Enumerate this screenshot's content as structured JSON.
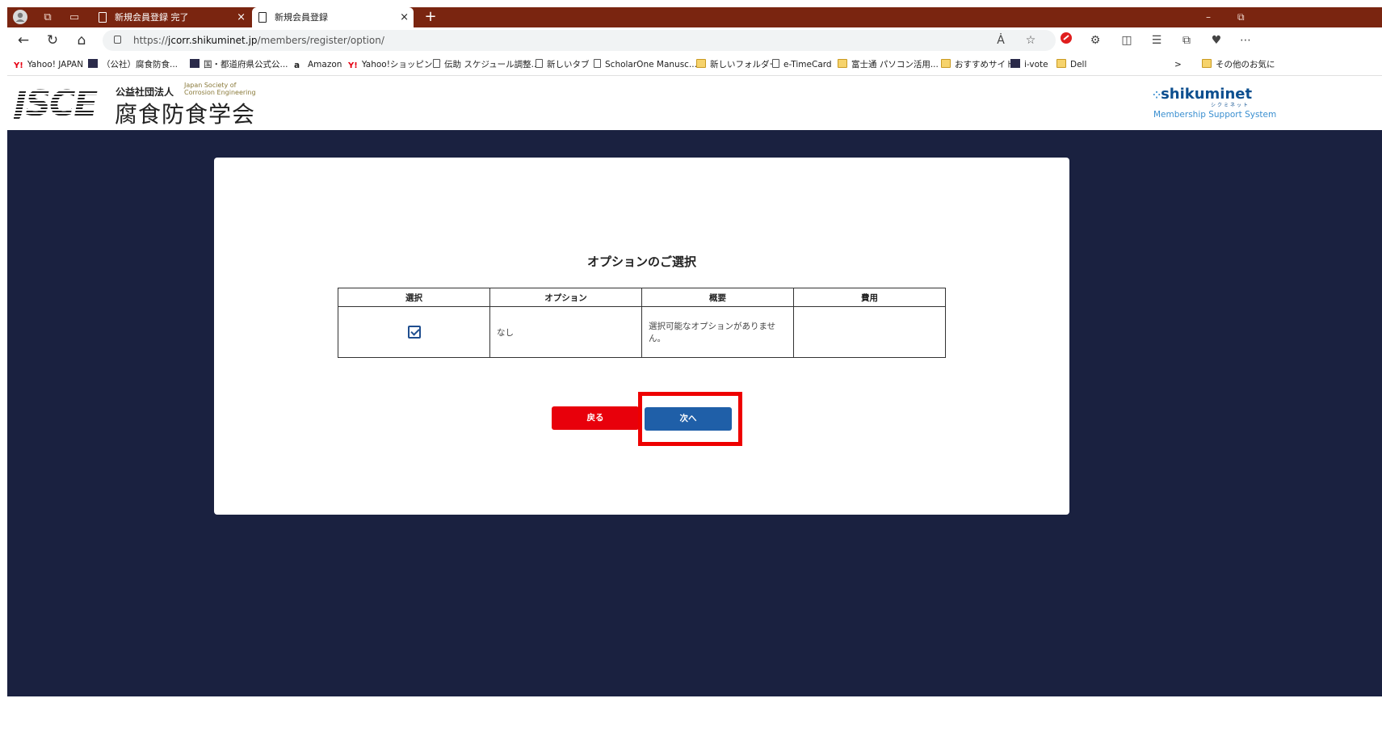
{
  "browser": {
    "tabs": [
      {
        "label": "新規会員登録 完了",
        "close": "×"
      },
      {
        "label": "新規会員登録",
        "close": "×"
      }
    ],
    "new_tab": "+",
    "window_controls": {
      "minimize": "–",
      "restore": "⧉"
    },
    "url": {
      "prefix": "https://",
      "domain": "jcorr.shikuminet.jp",
      "path": "/members/register/option/"
    },
    "read_aloud": "Ȧ"
  },
  "bookmarks": [
    {
      "label": "Yahoo! JAPAN",
      "icon": "yahoo"
    },
    {
      "label": "（公社）腐食防食...",
      "icon": "block"
    },
    {
      "label": "国・都道府県公式公...",
      "icon": "block"
    },
    {
      "label": "Amazon",
      "icon": "amazon"
    },
    {
      "label": "Yahoo!ショッピング",
      "icon": "yahoo"
    },
    {
      "label": "伝助 スケジュール調整...",
      "icon": "page"
    },
    {
      "label": "新しいタブ",
      "icon": "page"
    },
    {
      "label": "ScholarOne Manusc...",
      "icon": "page"
    },
    {
      "label": "新しいフォルダー",
      "icon": "folder"
    },
    {
      "label": "e-TimeCard",
      "icon": "page"
    },
    {
      "label": "富士通 パソコン活用...",
      "icon": "folder"
    },
    {
      "label": "おすすめサイト",
      "icon": "folder"
    },
    {
      "label": "i-vote",
      "icon": "block"
    },
    {
      "label": "Dell",
      "icon": "folder"
    }
  ],
  "bookmarks_more": ">",
  "bookmarks_other": "その他のお気に",
  "site": {
    "logo_text": "JSCE",
    "org_type": "公益社団法人",
    "org_en": "Japan Society of\nCorrosion Engineering",
    "org_name": "腐食防食学会",
    "system_logo": "shikuminet",
    "system_logo_kana": "シクミネット",
    "system_name": "Membership Support System"
  },
  "page": {
    "title": "オプションのご選択",
    "table": {
      "headers": [
        "選択",
        "オプション",
        "概要",
        "費用"
      ],
      "rows": [
        {
          "selected": true,
          "option": "なし",
          "summary": "選択可能なオプションがありません。",
          "fee": ""
        }
      ]
    },
    "back_button": "戻る",
    "next_button": "次へ"
  }
}
